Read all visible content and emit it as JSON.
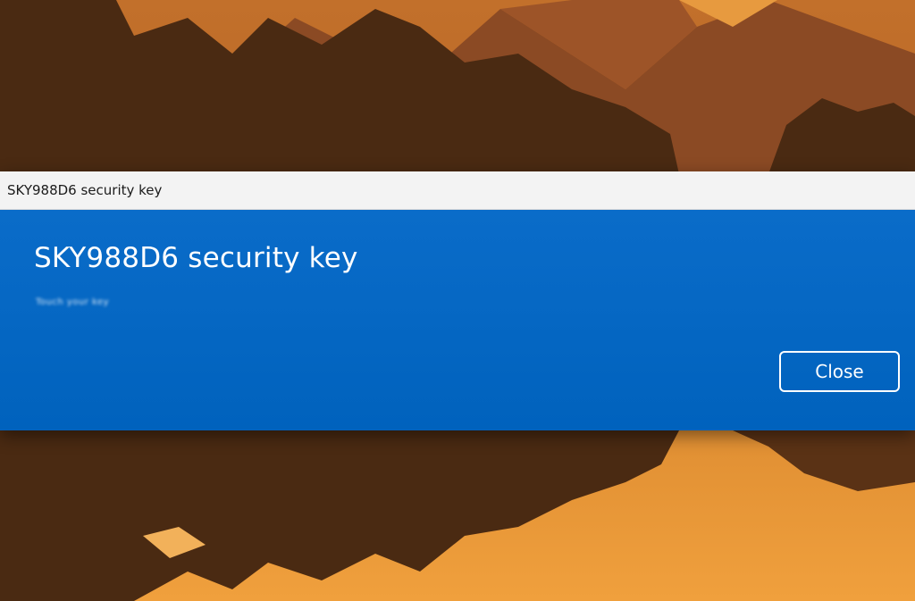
{
  "window": {
    "title": "SKY988D6 security key"
  },
  "dialog": {
    "heading": "SKY988D6 security key",
    "subtext": "Touch your key",
    "close_label": "Close"
  },
  "colors": {
    "dialog_blue": "#0067c0",
    "titlebar": "#f3f3f3",
    "wallpaper_sky": "#d98a3a"
  }
}
